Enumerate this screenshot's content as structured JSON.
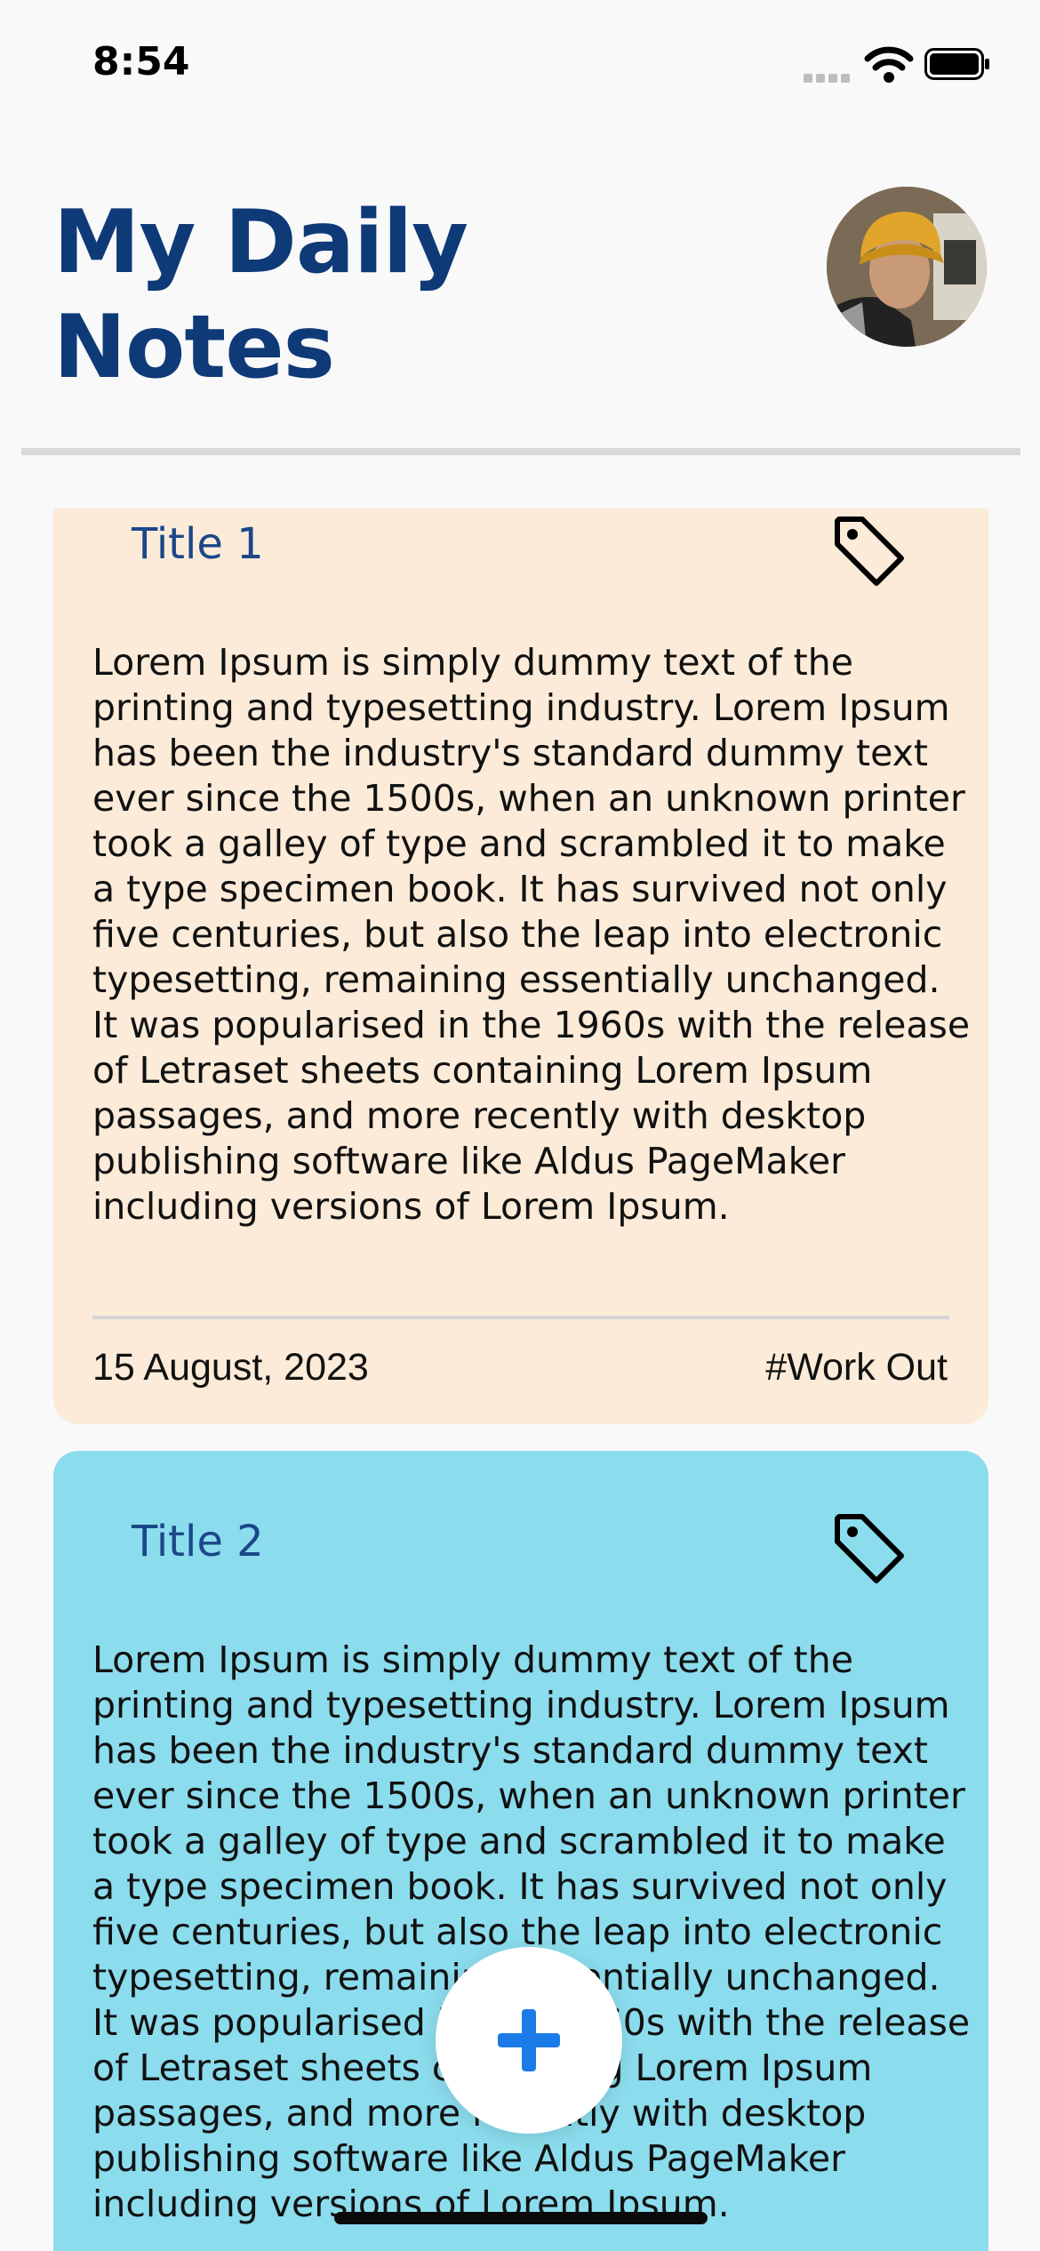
{
  "status_bar": {
    "time": "8:54"
  },
  "header": {
    "title_line1": "My Daily",
    "title_line2": "Notes"
  },
  "notes": [
    {
      "title": "Title 1",
      "body": "Lorem Ipsum is simply dummy text of the printing and typesetting industry. Lorem Ipsum has been the industry's standard dummy text ever since the 1500s, when an unknown printer took a galley of type and scrambled it to make a type specimen book. It has survived not only five centuries, but also the leap into electronic typesetting, remaining essentially unchanged. It was popularised in the 1960s with the release of Letraset sheets containing Lorem Ipsum passages, and more recently with desktop publishing software like Aldus PageMaker including versions of Lorem Ipsum.",
      "date": "15 August, 2023",
      "tag": "#Work Out",
      "color": "#fbebd8"
    },
    {
      "title": "Title 2",
      "body": "Lorem Ipsum is simply dummy text of the printing and typesetting industry. Lorem Ipsum has been the industry's standard dummy text ever since the 1500s, when an unknown printer took a galley of type and scrambled it to make a type specimen book. It has survived not only five centuries, but also the leap into electronic typesetting, remaining essentially unchanged. It was popularised in the 1960s with the release of Letraset sheets containing Lorem Ipsum passages, and more recently with desktop publishing software like Aldus PageMaker including versions of Lorem Ipsum.",
      "color": "#8bdced"
    }
  ],
  "icons": {
    "tag": "tag-icon",
    "add": "plus-icon",
    "wifi": "wifi-icon",
    "battery": "battery-icon",
    "signal": "signal-icon"
  },
  "colors": {
    "title": "#0f3a78",
    "accent_blue": "#1a7be8",
    "background": "#f9f9f9"
  }
}
